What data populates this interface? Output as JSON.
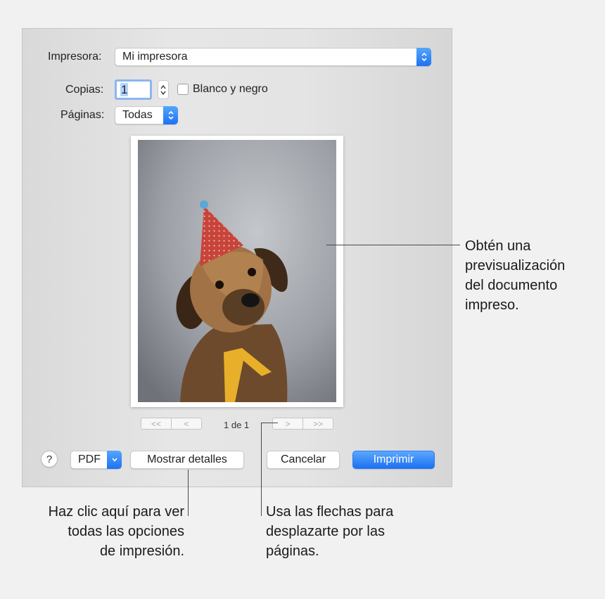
{
  "dialog": {
    "printer_label": "Impresora:",
    "printer_value": "Mi impresora",
    "copies_label": "Copias:",
    "copies_value": "1",
    "bw_label": "Blanco y negro",
    "pages_label": "Páginas:",
    "pages_value": "Todas",
    "page_counter": "1 de 1",
    "nav_first": "<<",
    "nav_prev": "<",
    "nav_next": ">",
    "nav_last": ">>",
    "help_label": "?",
    "pdf_label": "PDF",
    "details_label": "Mostrar detalles",
    "cancel_label": "Cancelar",
    "print_label": "Imprimir"
  },
  "callouts": {
    "preview": [
      "Obtén una",
      "previsualización",
      "del documento",
      "impreso."
    ],
    "details": [
      "Haz clic aquí para ver",
      "todas las opciones",
      "de impresión."
    ],
    "arrows": [
      "Usa las flechas para",
      "desplazarte por las",
      "páginas."
    ]
  },
  "colors": {
    "accent": "#1e72f3",
    "background": "#f1f1f1"
  }
}
